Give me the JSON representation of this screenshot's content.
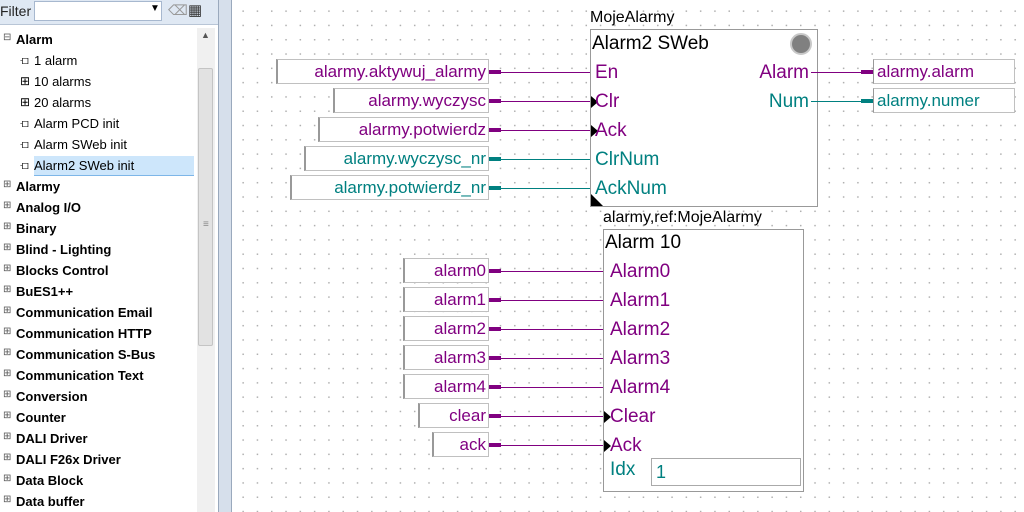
{
  "sidebar": {
    "filter_label": "Filter",
    "filter_value": "",
    "tree": [
      {
        "label": "Alarm",
        "type": "cat",
        "expanded": true
      },
      {
        "label": "1 alarm",
        "type": "leaf",
        "icon": "block-icon"
      },
      {
        "label": "10 alarms",
        "type": "leaf",
        "icon": "multi-block-icon"
      },
      {
        "label": "20 alarms",
        "type": "leaf",
        "icon": "multi-block-icon"
      },
      {
        "label": "Alarm PCD init",
        "type": "leaf",
        "icon": "block-icon"
      },
      {
        "label": "Alarm SWeb init",
        "type": "leaf",
        "icon": "block-icon"
      },
      {
        "label": "Alarm2 SWeb init",
        "type": "leaf",
        "icon": "block-icon",
        "selected": true
      },
      {
        "label": "Alarmy",
        "type": "cat"
      },
      {
        "label": "Analog I/O",
        "type": "cat"
      },
      {
        "label": "Binary",
        "type": "cat"
      },
      {
        "label": "Blind - Lighting",
        "type": "cat"
      },
      {
        "label": "Blocks Control",
        "type": "cat"
      },
      {
        "label": "BuES1++",
        "type": "cat"
      },
      {
        "label": "Communication Email",
        "type": "cat"
      },
      {
        "label": "Communication HTTP",
        "type": "cat"
      },
      {
        "label": "Communication S-Bus",
        "type": "cat"
      },
      {
        "label": "Communication Text",
        "type": "cat"
      },
      {
        "label": "Conversion",
        "type": "cat"
      },
      {
        "label": "Counter",
        "type": "cat"
      },
      {
        "label": "DALI Driver",
        "type": "cat"
      },
      {
        "label": "DALI F26x Driver",
        "type": "cat"
      },
      {
        "label": "Data Block",
        "type": "cat"
      },
      {
        "label": "Data buffer",
        "type": "cat"
      }
    ]
  },
  "colors": {
    "binary": "#800080",
    "integer": "#008080"
  },
  "block1": {
    "ref": "MojeAlarmy",
    "title": "Alarm2 SWeb",
    "status_led": "off",
    "inputs": [
      {
        "pin": "En",
        "var": "alarmy.aktywuj_alarmy",
        "kind": "binary",
        "edge": false
      },
      {
        "pin": "Clr",
        "var": "alarmy.wyczysc",
        "kind": "binary",
        "edge": true
      },
      {
        "pin": "Ack",
        "var": "alarmy.potwierdz",
        "kind": "binary",
        "edge": true
      },
      {
        "pin": "ClrNum",
        "var": "alarmy.wyczysc_nr",
        "kind": "integer",
        "edge": false
      },
      {
        "pin": "AckNum",
        "var": "alarmy.potwierdz_nr",
        "kind": "integer",
        "edge": false
      }
    ],
    "outputs": [
      {
        "pin": "Alarm",
        "var": "alarmy.alarm",
        "kind": "binary"
      },
      {
        "pin": "Num",
        "var": "alarmy.numer",
        "kind": "integer"
      }
    ]
  },
  "block2": {
    "ref": "alarmy,ref:MojeAlarmy",
    "title": "Alarm 10",
    "inputs": [
      {
        "pin": "Alarm0",
        "var": "alarm0",
        "edge": false
      },
      {
        "pin": "Alarm1",
        "var": "alarm1",
        "edge": false
      },
      {
        "pin": "Alarm2",
        "var": "alarm2",
        "edge": false
      },
      {
        "pin": "Alarm3",
        "var": "alarm3",
        "edge": false
      },
      {
        "pin": "Alarm4",
        "var": "alarm4",
        "edge": false
      },
      {
        "pin": "Clear",
        "var": "clear",
        "edge": true
      },
      {
        "pin": "Ack",
        "var": "ack",
        "edge": true
      }
    ],
    "idx_label": "Idx",
    "idx_value": "1"
  }
}
